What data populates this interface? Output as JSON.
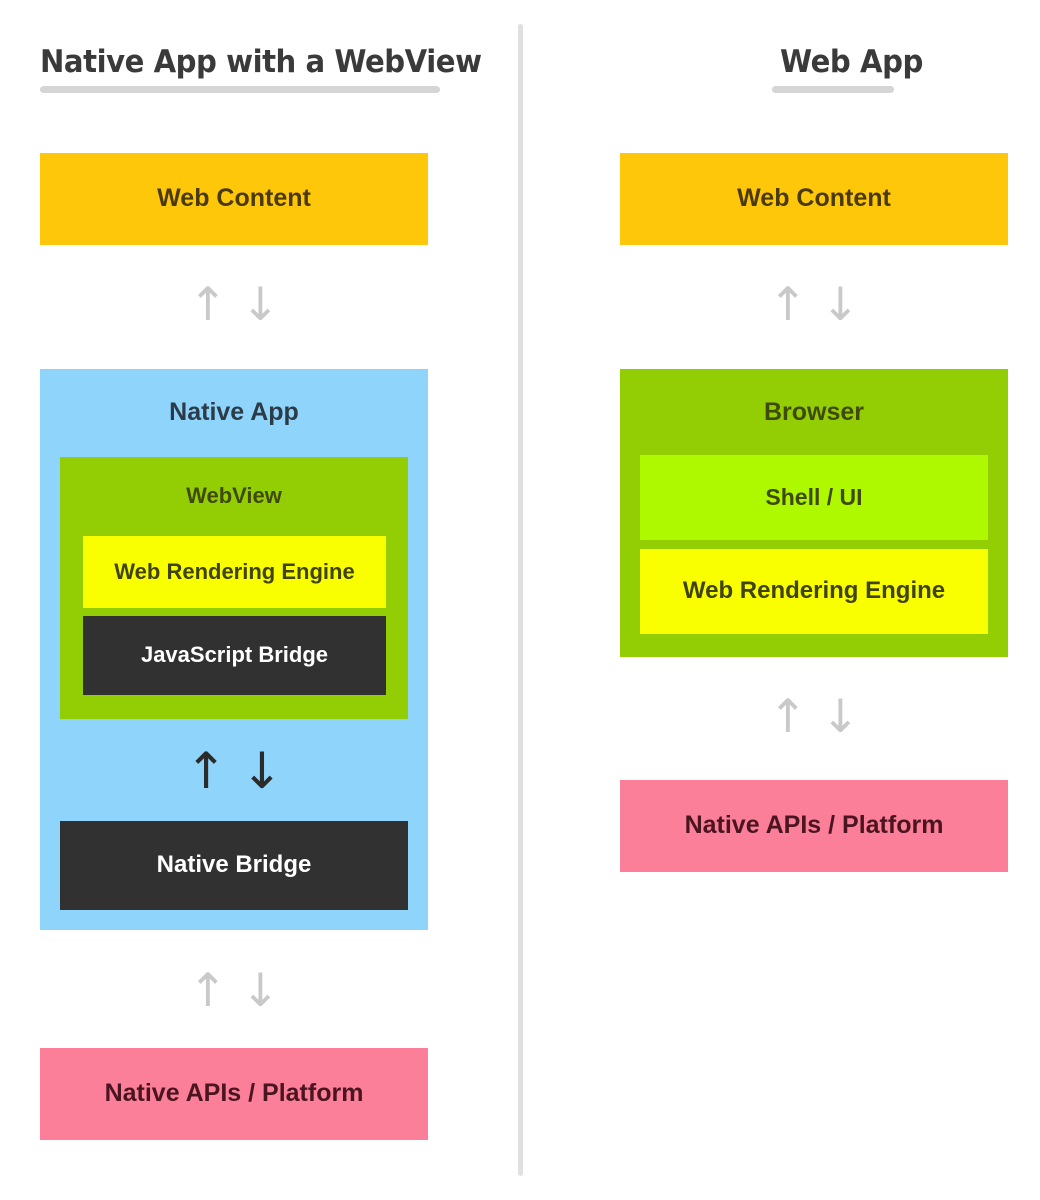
{
  "diagram": {
    "title_left": "Native App with a WebView",
    "title_right": "Web App",
    "arrow_up": "↑",
    "arrow_down": "↓"
  },
  "colors": {
    "background": "#ffffff",
    "divider": "#e0e0e0",
    "heading_text": "#3a3a3a",
    "heading_underline": "#d5d5d5",
    "web_content_bg": "#ffc709",
    "web_content_text": "#4a3a07",
    "native_app_bg": "#8fd4fb",
    "native_app_text": "#2c3b47",
    "webview_bg": "#93ce05",
    "webview_text": "#3f4a06",
    "browser_bg": "#93ce05",
    "browser_text": "#3f4a06",
    "shell_ui_bg": "#aef800",
    "shell_ui_text": "#3f4a06",
    "rendering_engine_bg": "#faff00",
    "rendering_engine_text": "#40430a",
    "bridge_bg": "#313131",
    "bridge_text": "#ffffff",
    "native_api_bg": "#fc7f99",
    "native_api_text": "#4a1520",
    "arrow_gray": "#c9c9c9",
    "arrow_dark": "#2b2b2b"
  },
  "left_column": {
    "web_content": {
      "label": "Web Content"
    },
    "arrows_top": {
      "up": "↑",
      "down": "↓",
      "tone": "gray"
    },
    "native_app": {
      "label": "Native App"
    },
    "webview": {
      "label": "WebView"
    },
    "web_rendering_engine": {
      "label": "Web Rendering Engine"
    },
    "javascript_bridge": {
      "label": "JavaScript Bridge"
    },
    "arrows_inner": {
      "up": "↑",
      "down": "↓",
      "tone": "dark"
    },
    "native_bridge": {
      "label": "Native Bridge"
    },
    "arrows_bottom": {
      "up": "↑",
      "down": "↓",
      "tone": "gray"
    },
    "native_apis": {
      "label": "Native APIs / Platform"
    }
  },
  "right_column": {
    "web_content": {
      "label": "Web Content"
    },
    "arrows_top": {
      "up": "↑",
      "down": "↓",
      "tone": "gray"
    },
    "browser": {
      "label": "Browser"
    },
    "shell_ui": {
      "label": "Shell / UI"
    },
    "web_rendering_engine": {
      "label": "Web Rendering Engine"
    },
    "arrows_bottom": {
      "up": "↑",
      "down": "↓",
      "tone": "gray"
    },
    "native_apis": {
      "label": "Native APIs / Platform"
    }
  }
}
